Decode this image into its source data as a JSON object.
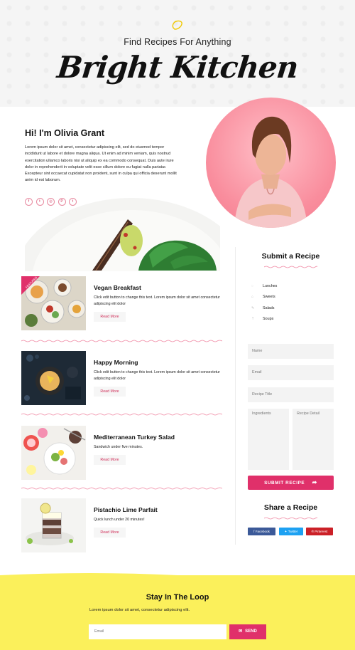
{
  "header": {
    "tagline": "Find Recipes For Anything",
    "brand": "Bright Kitchen"
  },
  "intro": {
    "title": "Hi! I'm Olivia Grant",
    "text": "Lorem ipsum dolor sit amet, consectetur adipiscing elit, sed do eiusmod tempor incididunt ut labore et dolore magna aliqua. Ut enim ad minim veniam, quis nostrud exercitation ullamco laboris nisi ut aliquip ex ea commodo consequat. Duis aute irure dolor in reprehenderit in voluptate velit esse cillum dolore eu fugiat nulla pariatur. Excepteur sint occaecat cupidatat non proident, sunt in culpa qui officia deserunt mollit anim id est laborum.",
    "socials": [
      "f",
      "t",
      "◎",
      "P",
      "t"
    ]
  },
  "posts": [
    {
      "title": "Vegan Breakfast",
      "text": "Click edit button to change this text. Lorem ipsum dolor sit amet consectetur adipiscing elit dolor",
      "read_more": "Read More",
      "badge": "FEATURED"
    },
    {
      "title": "Happy Morning",
      "text": "Click edit button to change this text. Lorem ipsum dolor sit amet consectetur adipiscing elit dolor",
      "read_more": "Read More"
    },
    {
      "title": "Mediterranean Turkey Salad",
      "text": "Sandwich under five minutes.",
      "read_more": "Read More"
    },
    {
      "title": "Pistachio Lime Parfait",
      "text": "Quick lunch under 20 minutes!",
      "read_more": "Read More"
    }
  ],
  "sidebar": {
    "submit_title": "Submit a Recipe",
    "categories": [
      "Lunches",
      "Sweets",
      "Salads",
      "Soups"
    ],
    "form": {
      "name": "Name",
      "email": "Email",
      "recipe_title": "Recipe Title",
      "ingredients": "Ingredients",
      "recipe_detail": "Recipe Detail",
      "submit": "SUBMIT RECIPE"
    },
    "share_title": "Share a Recipe",
    "share": [
      "Facebook",
      "Twitter",
      "Pinterest"
    ]
  },
  "newsletter": {
    "title": "Stay In The Loop",
    "text": "Lorem ipsum dolor sit amet, consectetur adipiscing elit.",
    "email_placeholder": "Email",
    "send": "SEND"
  },
  "colors": {
    "accent": "#e0306a",
    "pink": "#f98d9d",
    "yellow": "#fbf05b",
    "facebook": "#3b5998",
    "twitter": "#1da1f2",
    "pinterest": "#cb2027"
  }
}
